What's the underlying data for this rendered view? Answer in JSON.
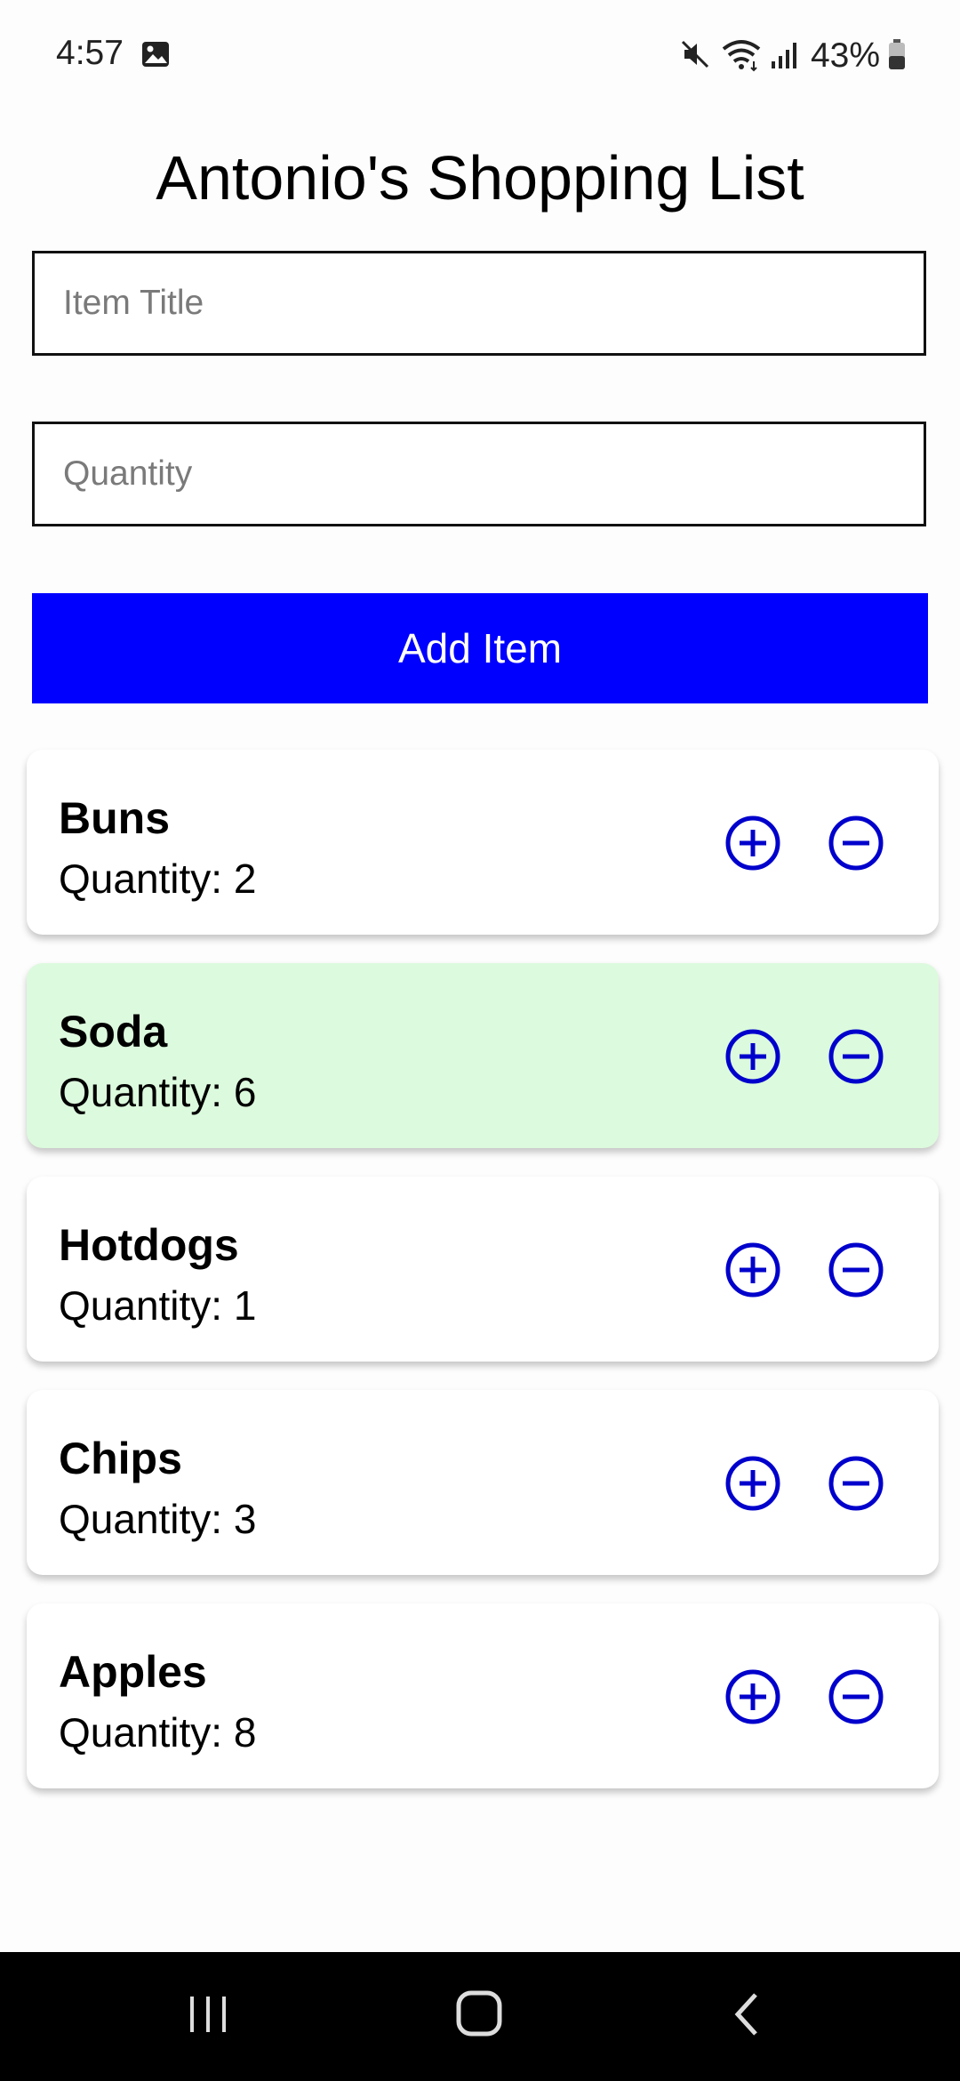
{
  "status_bar": {
    "time": "4:57",
    "battery": "43%",
    "icons": [
      "image-icon",
      "mute-icon",
      "wifi-icon",
      "signal-icon",
      "battery-icon"
    ]
  },
  "page": {
    "title": "Antonio's Shopping List"
  },
  "form": {
    "title_placeholder": "Item Title",
    "quantity_placeholder": "Quantity",
    "add_button_label": "Add Item"
  },
  "items": [
    {
      "name": "Buns",
      "quantity": "Quantity: 2"
    },
    {
      "name": "Soda",
      "quantity": "Quantity: 6"
    },
    {
      "name": "Hotdogs",
      "quantity": "Quantity: 1"
    },
    {
      "name": "Chips",
      "quantity": "Quantity: 3"
    },
    {
      "name": "Apples",
      "quantity": "Quantity: 8"
    }
  ],
  "colors": {
    "accent": "#0000ff",
    "highlight_card": "#dcfadd",
    "icon_stroke": "#0000cc"
  },
  "nav_bar": {
    "icons": [
      "recents-icon",
      "home-icon",
      "back-icon"
    ]
  }
}
